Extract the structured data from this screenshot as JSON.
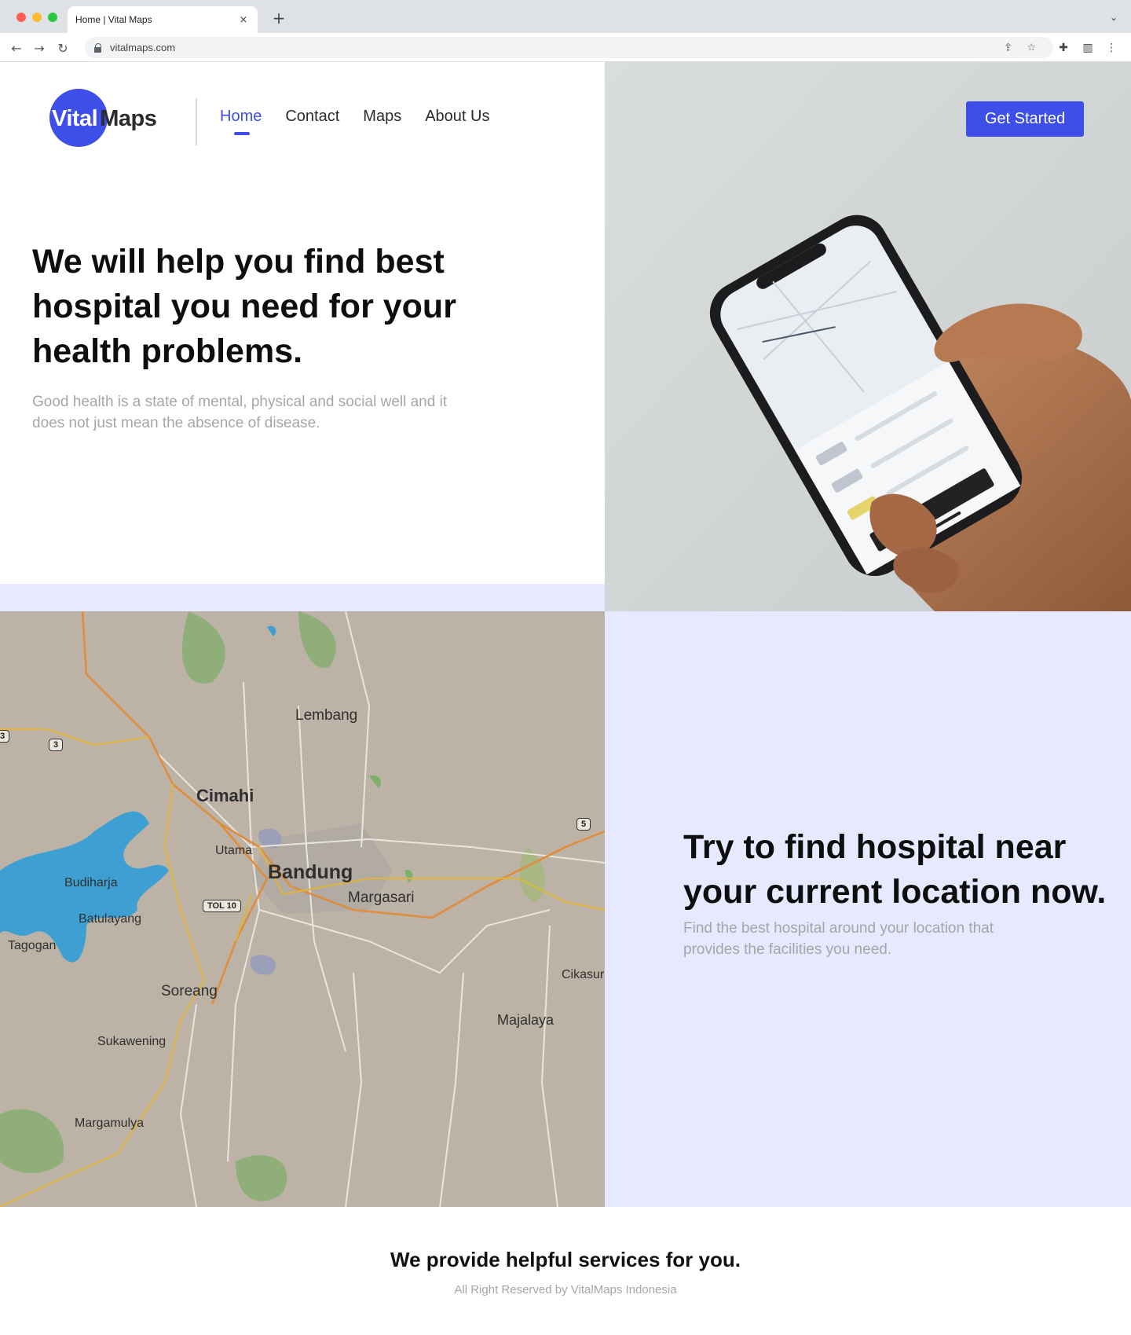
{
  "browser": {
    "tab_title": "Home | Vital Maps",
    "close_glyph": "×",
    "new_tab_glyph": "+",
    "tab_menu_glyph": "⌄",
    "url": "vitalmaps.com",
    "back_glyph": "←",
    "forward_glyph": "→",
    "reload_glyph": "↻",
    "share_glyph": "⇪",
    "star_glyph": "☆",
    "extensions_glyph": "✚",
    "sidepanel_glyph": "▥",
    "menu_glyph": "⋮"
  },
  "colors": {
    "accent": "#3d4fe8",
    "panel": "#e6e9ff"
  },
  "header": {
    "logo_part1": "Vital",
    "logo_part2": "Maps",
    "nav": [
      "Home",
      "Contact",
      "Maps",
      "About Us"
    ],
    "active": "Home",
    "cta": "Get Started"
  },
  "hero": {
    "title": "We will help you find best hospital you need for your health problems.",
    "subtitle": "Good health is a state of mental, physical and social well and it does not just mean the absence of disease."
  },
  "map": {
    "labels": {
      "lembang": "Lembang",
      "cimahi": "Cimahi",
      "utama": "Utama",
      "bandung": "Bandung",
      "margasari": "Margasari",
      "budiharja": "Budiharja",
      "batulayang": "Batulayang",
      "tagogan": "Tagogan",
      "soreang": "Soreang",
      "cikasur": "Cikasur",
      "majalaya": "Majalaya",
      "sukawening": "Sukawening",
      "margamulya": "Margamulya"
    },
    "route_badges": {
      "r3a": "3",
      "r3b": "3",
      "r5": "5",
      "tol10": "TOL 10"
    }
  },
  "find": {
    "title": "Try to find hospital near your current location now.",
    "subtitle": "Find the best hospital around your location that provides the facilities you need."
  },
  "footer": {
    "title": "We provide helpful services for you.",
    "copyright": "All  Right Reserved by VitalMaps Indonesia"
  },
  "icons": {
    "lock": "lock-icon",
    "back": "arrow-left-icon",
    "forward": "arrow-right-icon",
    "reload": "reload-icon",
    "share": "share-icon",
    "bookmark": "star-icon",
    "extensions": "puzzle-icon",
    "sidepanel": "side-panel-icon",
    "menu": "kebab-menu-icon"
  }
}
